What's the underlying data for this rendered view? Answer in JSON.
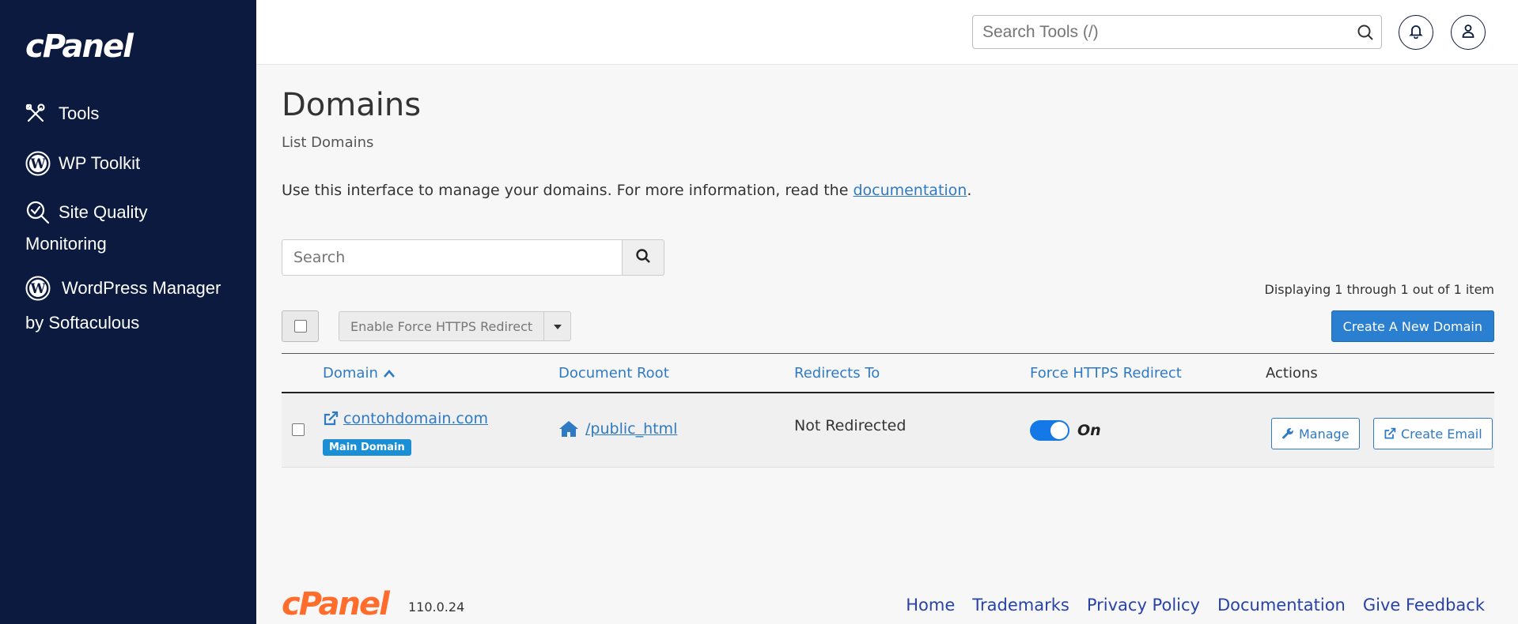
{
  "sidebar": {
    "logo": "cPanel",
    "items": [
      {
        "label": "Tools",
        "icon": "tools-icon"
      },
      {
        "label": "WP Toolkit",
        "icon": "wordpress-icon"
      },
      {
        "label": "Site Quality",
        "label2": "Monitoring",
        "icon": "site-quality-icon"
      },
      {
        "label": "WordPress Manager",
        "label2": "by Softaculous",
        "icon": "wordpress-icon"
      }
    ]
  },
  "topbar": {
    "search_placeholder": "Search Tools (/)"
  },
  "page": {
    "title": "Domains",
    "subtitle": "List Domains",
    "intro_text": "Use this interface to manage your domains. For more information, read the ",
    "intro_link": "documentation",
    "intro_end": ".",
    "search_placeholder": "Search",
    "displaying": "Displaying 1 through 1 out of 1 item",
    "force_https_label": "Enable Force HTTPS Redirect",
    "create_label": "Create A New Domain"
  },
  "table": {
    "headers": {
      "domain": "Domain",
      "docroot": "Document Root",
      "redirects": "Redirects To",
      "force": "Force HTTPS Redirect",
      "actions": "Actions"
    },
    "rows": [
      {
        "domain": "contohdomain.com",
        "badge": "Main Domain",
        "docroot": "/public_html",
        "redirects": "Not Redirected",
        "force_state": "On",
        "manage": "Manage",
        "create_email": "Create Email"
      }
    ]
  },
  "footer": {
    "logo": "cPanel",
    "version": "110.0.24",
    "links": [
      "Home",
      "Trademarks",
      "Privacy Policy",
      "Documentation",
      "Give Feedback"
    ]
  },
  "colors": {
    "sidebar_bg": "#0c1a3f",
    "accent": "#2f7ac3",
    "primary_button": "#2a7fd0",
    "toggle_on": "#1479e6",
    "badge": "#1b8fd6",
    "footer_logo": "#ff6c2c",
    "footer_link": "#2742a8"
  }
}
